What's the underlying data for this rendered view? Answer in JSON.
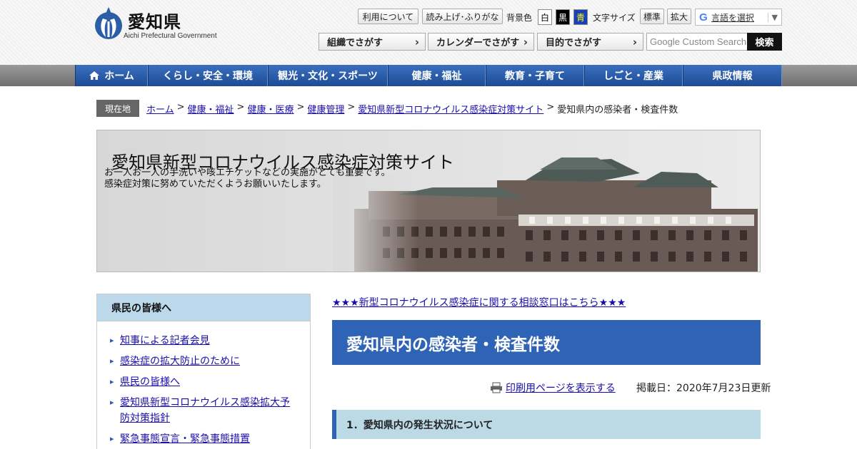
{
  "logo": {
    "title": "愛知県",
    "subtitle": "Aichi Prefectural Government"
  },
  "utility": {
    "about": "利用について",
    "read_aloud": "読み上げ･ふりがな",
    "bg_label": "背景色",
    "bg_white": "白",
    "bg_black": "黒",
    "bg_blue": "青",
    "font_label": "文字サイズ",
    "font_normal": "標準",
    "font_large": "拡大",
    "lang_select": "言語を選択"
  },
  "search": {
    "by_org": "組織でさがす",
    "by_calendar": "カレンダーでさがす",
    "by_purpose": "目的でさがす",
    "placeholder": "Google Custom Search",
    "submit": "検索"
  },
  "nav": {
    "items": [
      "ホーム",
      "くらし・安全・環境",
      "観光・文化・スポーツ",
      "健康・福祉",
      "教育・子育て",
      "しごと・産業",
      "県政情報"
    ]
  },
  "breadcrumb": {
    "label": "現在地",
    "links": [
      "ホーム",
      "健康・福祉",
      "健康・医療",
      "健康管理",
      "愛知県新型コロナウイルス感染症対策サイト"
    ],
    "current": "愛知県内の感染者・検査件数",
    "separator": ">"
  },
  "banner": {
    "title": "愛知県新型コロナウイルス感染症対策サイト",
    "line1": "お一人お一人の手洗いや咳エチケットなどの実施がとても重要です。",
    "line2": "感染症対策に努めていただくようお願いいたします。"
  },
  "sidebar": {
    "heading": "県民の皆様へ",
    "items": [
      "知事による記者会見",
      "感染症の拡大防止のために",
      "県民の皆様へ",
      "愛知県新型コロナウイルス感染拡大予防対策指針",
      "緊急事態宣言・緊急事態措置"
    ]
  },
  "main": {
    "notice": "★★★新型コロナウイルス感染症に関する相談窓口はこちら★★★",
    "title": "愛知県内の感染者・検査件数",
    "print_link": "印刷用ページを表示する",
    "date": "掲載日：2020年7月23日更新",
    "section1": "1．愛知県内の発生状況について"
  },
  "colors": {
    "nav_blue": "#2f63b5",
    "title_blue": "#2f63b5",
    "section_bg": "#bcd9e6",
    "sidebar_head": "#bcd9ec",
    "link": "#1a0dab"
  }
}
